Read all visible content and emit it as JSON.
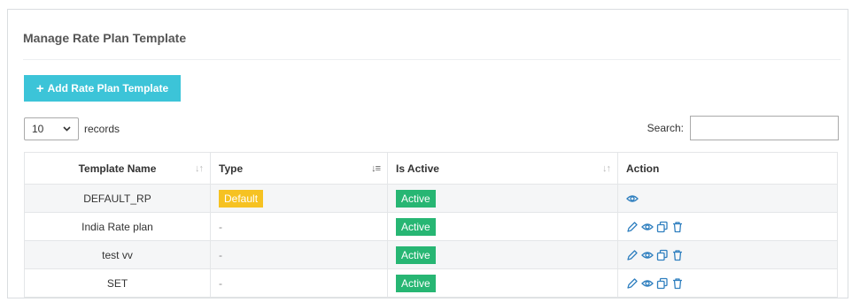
{
  "page": {
    "title": "Manage Rate Plan Template"
  },
  "toolbar": {
    "add_label": "Add Rate Plan Template",
    "add_icon": "plus-icon"
  },
  "length_menu": {
    "value": "10",
    "suffix": "records"
  },
  "search": {
    "label": "Search:",
    "value": ""
  },
  "table": {
    "headers": [
      "Template Name",
      "Type",
      "Is Active",
      "Action"
    ],
    "rows": [
      {
        "name": "DEFAULT_RP",
        "type": "Default",
        "active": "Active",
        "actions": [
          "view-icon"
        ]
      },
      {
        "name": "India Rate plan",
        "type": "-",
        "active": "Active",
        "actions": [
          "edit-icon",
          "view-icon",
          "copy-icon",
          "delete-icon"
        ]
      },
      {
        "name": "test vv",
        "type": "-",
        "active": "Active",
        "actions": [
          "edit-icon",
          "view-icon",
          "copy-icon",
          "delete-icon"
        ]
      },
      {
        "name": "SET",
        "type": "-",
        "active": "Active",
        "actions": [
          "edit-icon",
          "view-icon",
          "copy-icon",
          "delete-icon"
        ]
      }
    ]
  },
  "colors": {
    "accent": "#3cc4d8",
    "default_badge": "#f6c222",
    "active_badge": "#27b673",
    "icon": "#2f7fbf"
  }
}
